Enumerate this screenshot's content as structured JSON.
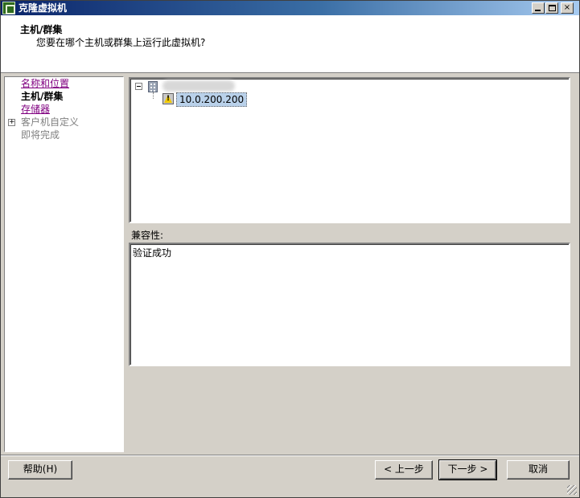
{
  "window": {
    "title": "克隆虚拟机",
    "controls": {
      "minimize": "_",
      "maximize": "□",
      "close": "×"
    }
  },
  "header": {
    "title": "主机/群集",
    "subtitle": "您要在哪个主机或群集上运行此虚拟机?"
  },
  "nav": {
    "items": [
      {
        "label": "名称和位置",
        "state": "visited"
      },
      {
        "label": "主机/群集",
        "state": "current"
      },
      {
        "label": "存储器",
        "state": "visited"
      },
      {
        "label": "客户机自定义",
        "state": "disabled",
        "expander": "+"
      },
      {
        "label": "即将完成",
        "state": "disabled"
      }
    ]
  },
  "tree": {
    "host_label": "10.0.200.200"
  },
  "compatibility": {
    "label": "兼容性:",
    "message": "验证成功"
  },
  "buttons": {
    "help": "帮助(H)",
    "back": "< 上一步",
    "next": "下一步 >",
    "cancel": "取消"
  }
}
